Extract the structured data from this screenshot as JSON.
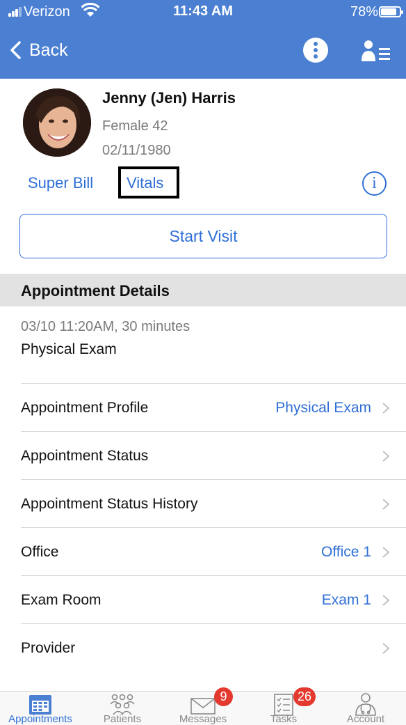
{
  "status_bar": {
    "carrier": "Verizon",
    "time": "11:43 AM",
    "battery": "78%"
  },
  "nav": {
    "back_label": "Back",
    "more_icon": "more-vertical-circle-icon",
    "menu_icon": "patient-list-icon"
  },
  "patient": {
    "name": "Jenny (Jen) Harris",
    "gender_age": "Female 42",
    "dob": "02/11/1980",
    "links": {
      "super_bill": "Super Bill",
      "vitals": "Vitals"
    },
    "info_icon": "i"
  },
  "start_visit_label": "Start Visit",
  "appointment": {
    "section_title": "Appointment Details",
    "when": "03/10 11:20AM, 30 minutes",
    "type": "Physical Exam",
    "rows": [
      {
        "label": "Appointment Profile",
        "value": "Physical Exam"
      },
      {
        "label": "Appointment Status",
        "value": ""
      },
      {
        "label": "Appointment Status History",
        "value": ""
      },
      {
        "label": "Office",
        "value": "Office 1"
      },
      {
        "label": "Exam Room",
        "value": "Exam 1"
      },
      {
        "label": "Provider",
        "value": ""
      }
    ]
  },
  "tabbar": {
    "tabs": [
      {
        "label": "Appointments",
        "icon": "calendar-icon",
        "badge": ""
      },
      {
        "label": "Patients",
        "icon": "people-icon",
        "badge": ""
      },
      {
        "label": "Messages",
        "icon": "envelope-icon",
        "badge": "9"
      },
      {
        "label": "Tasks",
        "icon": "checklist-icon",
        "badge": "26"
      },
      {
        "label": "Account",
        "icon": "doctor-icon",
        "badge": ""
      }
    ]
  },
  "colors": {
    "nav_blue": "#4a7fd2",
    "link_blue": "#2f6fd6",
    "badge_red": "#e4392f",
    "section_gray": "#e2e2e2"
  }
}
